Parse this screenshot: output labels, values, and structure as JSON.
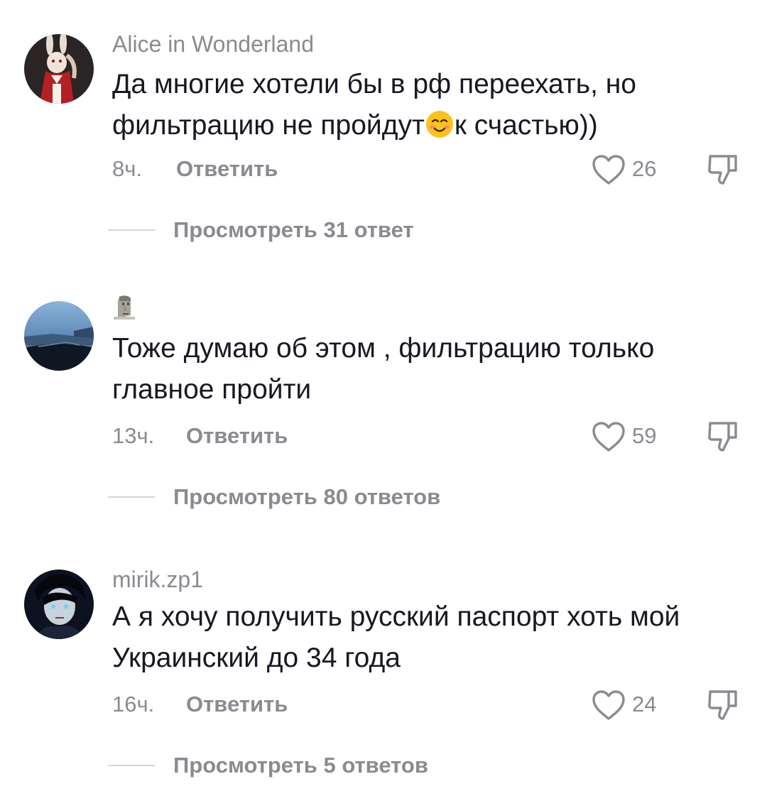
{
  "comments": [
    {
      "username": "Alice in Wonderland",
      "text_before_emoji": "Да многие хотели бы в рф переехать, но фильтрацию не пройдут",
      "emoji": "smiling-face-emoji",
      "text_after_emoji": "к счастью))",
      "time": "8ч.",
      "reply_label": "Ответить",
      "likes": "26",
      "view_replies": "Просмотреть 31 ответ"
    },
    {
      "username_icon": "moai-emoji",
      "text": "Тоже думаю об этом , фильтрацию только главное пройти",
      "time": "13ч.",
      "reply_label": "Ответить",
      "likes": "59",
      "view_replies": "Просмотреть 80 ответов"
    },
    {
      "username": "mirik.zp1",
      "text": "А я хочу получить русский паспорт хоть мой Украинский до 34 года",
      "time": "16ч.",
      "reply_label": "Ответить",
      "likes": "24",
      "view_replies": "Просмотреть 5 ответов"
    }
  ],
  "icons": {
    "like": "heart-outline-icon",
    "dislike": "thumbs-down-outline-icon"
  },
  "colors": {
    "text": "#161823",
    "secondary": "#8a8b91",
    "divider": "#d5d5d8"
  }
}
